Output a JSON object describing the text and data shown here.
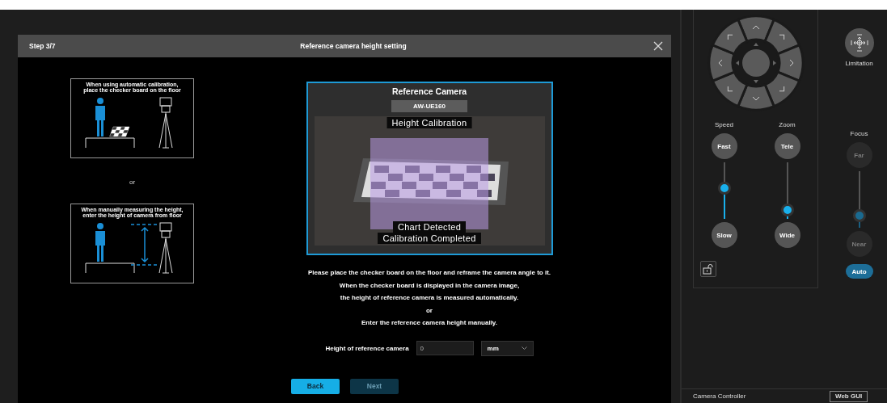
{
  "dialog": {
    "step": "Step 3/7",
    "title": "Reference camera height setting",
    "guides": [
      {
        "kind": "auto",
        "caption_lines": [
          "When using automatic calibration,",
          "place the checker board on the floor"
        ]
      },
      {
        "kind": "manual",
        "caption_lines": [
          "When manually measuring the height,",
          "enter the height of camera from floor"
        ]
      }
    ],
    "guide_separator": "or",
    "preview": {
      "title": "Reference Camera",
      "model": "AW-UE160",
      "top_label": "Height Calibration",
      "status_labels": [
        "Chart Detected",
        "Calibration Completed"
      ]
    },
    "instructions": [
      "Please place the checker board on the floor and reframe the camera angle to it.",
      "When the checker board is displayed in the camera image,",
      "the height of reference camera is measured automatically.",
      "or",
      "Enter the reference camera height manually."
    ],
    "height_field": {
      "label": "Height of reference camera",
      "value": "0",
      "unit": "mm"
    },
    "buttons": [
      {
        "label": "Back",
        "disabled": false
      },
      {
        "label": "Next",
        "disabled": true
      }
    ]
  },
  "controls": {
    "limitation": "Limitation",
    "sliders": [
      {
        "label": "Speed",
        "top": "Fast",
        "bottom": "Slow",
        "level": 0.53,
        "disabled": false
      },
      {
        "label": "Zoom",
        "top": "Tele",
        "bottom": "Wide",
        "level": 0.15,
        "disabled": false
      },
      {
        "label": "Focus",
        "top": "Far",
        "bottom": "Near",
        "level": 0.2,
        "disabled": true
      }
    ],
    "auto_focus": {
      "label": "Auto",
      "on": true
    },
    "footer": {
      "selector": "Camera Controller",
      "button": "Web GUI"
    }
  }
}
